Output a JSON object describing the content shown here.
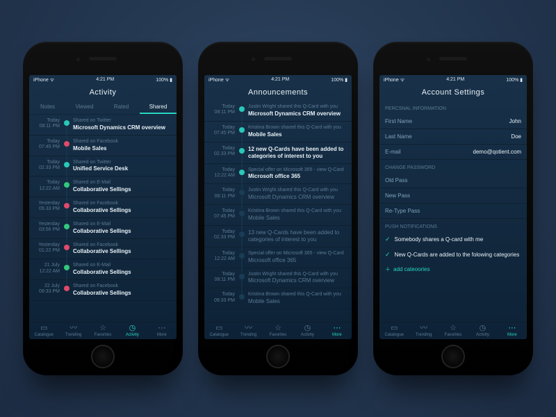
{
  "status": {
    "carrier": "iPhone",
    "signal": "📶",
    "wifi": "᯾",
    "time": "4:21 PM",
    "battery": "100%",
    "batt_icon": "▮"
  },
  "screen1": {
    "title": "Activity",
    "tabs": [
      "Notes",
      "Viewed",
      "Rated",
      "Shared"
    ],
    "active": 3,
    "items": [
      {
        "d": "Today",
        "t": "08:11 PM",
        "sub": "Shared on Twitter",
        "main": "Microsoft Dynamics CRM overview",
        "c": "#29c8b8"
      },
      {
        "d": "Today",
        "t": "07:45 PM",
        "sub": "Shared on Facebook",
        "main": "Mobile Sales",
        "c": "#e04a6b"
      },
      {
        "d": "Today",
        "t": "02.33 PM",
        "sub": "Shared on Twitter",
        "main": "Unified Service Desk",
        "c": "#29c8b8"
      },
      {
        "d": "Today",
        "t": "12:22 AM",
        "sub": "Shared on E-Mail",
        "main": "Collaborative Sellings",
        "c": "#34c77c"
      },
      {
        "d": "Yesterday",
        "t": "09.33 PM",
        "sub": "Shared on Facebook",
        "main": "Collaborative Sellings",
        "c": "#e04a6b"
      },
      {
        "d": "Yesterday",
        "t": "03:56 PM",
        "sub": "Shared on E-Mail",
        "main": "Collaborative Sellings",
        "c": "#34c77c"
      },
      {
        "d": "Yesterday",
        "t": "01:22 PM",
        "sub": "Shared on Facebook",
        "main": "Collaborative Sellings",
        "c": "#e04a6b"
      },
      {
        "d": "21 July",
        "t": "12:22 AM",
        "sub": "Shared on E-Mail",
        "main": "Collaborative Sellings",
        "c": "#34c77c"
      },
      {
        "d": "22 July",
        "t": "09:33 PM",
        "sub": "Shared on Facebook",
        "main": "Collaborative Sellings",
        "c": "#e04a6b"
      }
    ]
  },
  "screen2": {
    "title": "Announcements",
    "items": [
      {
        "d": "Today",
        "t": "08:11 PM",
        "sub": "Justin Wright shared this Q-Card with you",
        "main": "Microsoft Dynamics CRM overview",
        "c": "#29c8b8",
        "bold": true
      },
      {
        "d": "Today",
        "t": "07:45 PM",
        "sub": "Kristina Brown shared this Q-Card with you",
        "main": "Mobile Sales",
        "c": "#29c8b8",
        "bold": true
      },
      {
        "d": "Today",
        "t": "02.33 PM",
        "sub": "",
        "main": "12 new Q-Cards have been added to categories of interest to you",
        "c": "#29c8b8",
        "bold": true
      },
      {
        "d": "Today",
        "t": "12:22 AM",
        "sub": "Special offer on Microsoft 365 - view Q-Card",
        "main": "Microsoft office 365",
        "c": "#29c8b8",
        "bold": true
      },
      {
        "d": "Today",
        "t": "08:11 PM",
        "sub": "Justin Wright shared this Q-Card with you",
        "main": "Microsoft Dynamics CRM overview",
        "c": "#1a3c55",
        "dim": true
      },
      {
        "d": "Today",
        "t": "07:45 PM",
        "sub": "Kristina Brown shared this Q-Card with you",
        "main": "Mobile Sales",
        "c": "#1a3c55",
        "dim": true
      },
      {
        "d": "Today",
        "t": "02.33 PM",
        "sub": "",
        "main": "13 new Q-Cards have been added to categories of interest to you",
        "c": "#1a3c55",
        "dim": true
      },
      {
        "d": "Today",
        "t": "12:22 AM",
        "sub": "Special offer on Microsoft 365 - view Q-Card",
        "main": "Microsoft office 365",
        "c": "#1a3c55",
        "dim": true
      },
      {
        "d": "Today",
        "t": "08:11 PM",
        "sub": "Justin Wright shared this Q-Card with you",
        "main": "Microsoft Dynamics CRM overview",
        "c": "#1a3c55",
        "dim": true
      },
      {
        "d": "Today",
        "t": "09:33 PM",
        "sub": "Kristina Brown shared this Q-Card with you",
        "main": "Mobile Sales",
        "c": "#1a3c55",
        "dim": true
      }
    ]
  },
  "screen3": {
    "title": "Account Settings",
    "s1": "PERCSNAL INFORMATION",
    "first_label": "First Name",
    "first_val": "John",
    "last_label": "Last Name",
    "last_val": "Doe",
    "email_label": "E-mail",
    "email_val": "demo@qotient.com",
    "s2": "CHANGE PASSWORD",
    "old": "Old Pass",
    "new": "New Pass",
    "re": "Re-Type Pass",
    "s3": "PUSH NOTIFICATIONS",
    "n1": "Somebody shares a Q-card with me",
    "n2": "New Q-Cards are added to the folowing categories",
    "addcat": "add cateoories"
  },
  "tabbar": {
    "items": [
      {
        "icon": "▭",
        "label": "Catalogue"
      },
      {
        "icon": "〰",
        "label": "Trending"
      },
      {
        "icon": "☆",
        "label": "Favorites"
      },
      {
        "icon": "◷",
        "label": "Activity"
      },
      {
        "icon": "⋯",
        "label": "More"
      }
    ]
  }
}
